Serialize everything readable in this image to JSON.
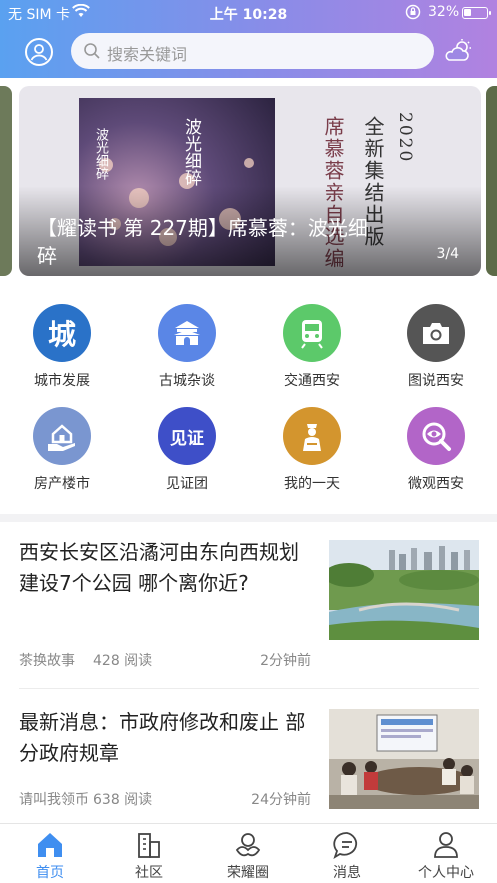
{
  "status_bar": {
    "carrier": "无 SIM 卡",
    "time": "上午 10:28",
    "battery": "32%"
  },
  "header": {
    "search_placeholder": "搜索关键词",
    "avatar_icon": "user-icon",
    "weather_icon": "weather-cloud-icon"
  },
  "banner": {
    "caption": "【耀读书 第 227期】席慕蓉：波光细碎",
    "indicator": "3/4",
    "book_text": {
      "year": "2020",
      "edition": "全新集结出版",
      "author_line": "席慕蓉亲自选编",
      "book_title": "波光细碎",
      "book_spine": "波光细碎"
    }
  },
  "categories": [
    {
      "label": "城市发展",
      "icon": "city-char-icon",
      "glyph": "城",
      "color": "#2a72c8"
    },
    {
      "label": "古城杂谈",
      "icon": "ancient-gate-icon",
      "color": "#5a86e6"
    },
    {
      "label": "交通西安",
      "icon": "train-icon",
      "color": "#5cc96a"
    },
    {
      "label": "图说西安",
      "icon": "camera-icon",
      "color": "#555555"
    },
    {
      "label": "房产楼市",
      "icon": "house-hand-icon",
      "color": "#7a96d0"
    },
    {
      "label": "见证团",
      "icon": "witness-badge-icon",
      "glyph": "见证",
      "color": "#3e4fc8"
    },
    {
      "label": "我的一天",
      "icon": "terracotta-icon",
      "color": "#d3952e"
    },
    {
      "label": "微观西安",
      "icon": "eye-magnifier-icon",
      "color": "#b265c8"
    }
  ],
  "articles": [
    {
      "title": "西安长安区沿潏河由东向西规划建设7个公园 哪个离你近?",
      "source": "茶换故事",
      "reads": "428 阅读",
      "time": "2分钟前"
    },
    {
      "title": "最新消息：市政府修改和废止 部分政府规章",
      "source": "请叫我领币",
      "reads": "638 阅读",
      "time": "24分钟前"
    }
  ],
  "tabs": [
    {
      "label": "首页",
      "icon": "home-icon",
      "active": true
    },
    {
      "label": "社区",
      "icon": "buildings-icon",
      "active": false
    },
    {
      "label": "荣耀圈",
      "icon": "honor-circle-icon",
      "active": false
    },
    {
      "label": "消息",
      "icon": "message-icon",
      "active": false
    },
    {
      "label": "个人中心",
      "icon": "person-icon",
      "active": false
    }
  ],
  "colors": {
    "accent": "#3f8ef0",
    "header_start": "#5aa1f0",
    "header_end": "#b182e0"
  }
}
